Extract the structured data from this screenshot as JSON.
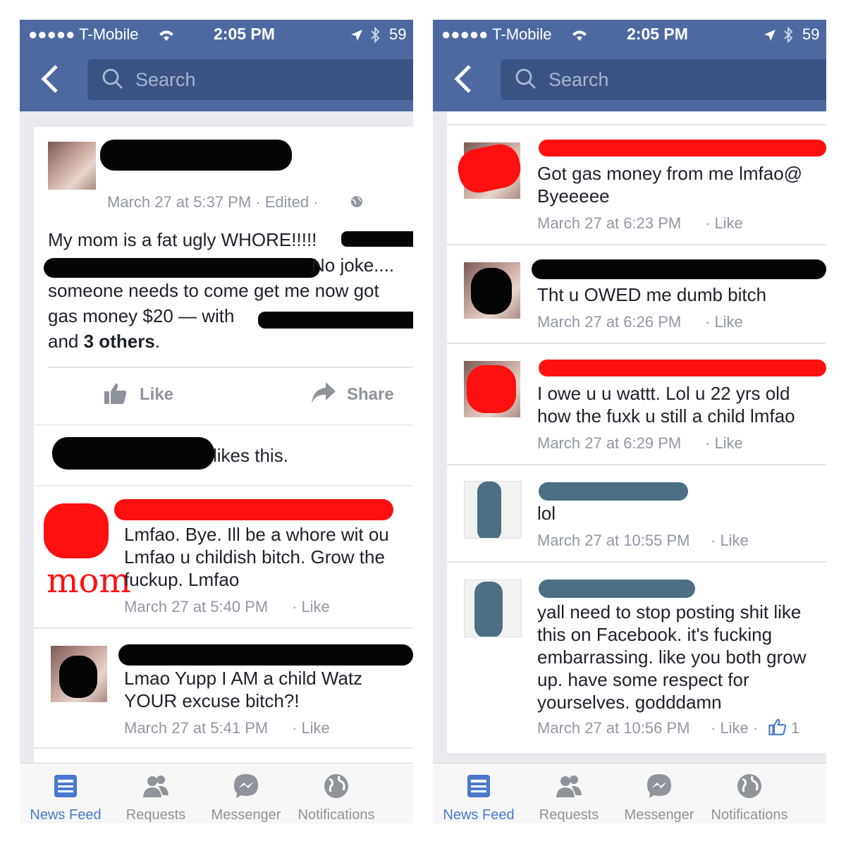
{
  "status": {
    "carrier": "●●●●● T-Mobile",
    "time": "2:05 PM",
    "battery": "59"
  },
  "search": {
    "placeholder": "Search"
  },
  "left": {
    "post": {
      "meta": "March 27 at 5:37 PM · Edited ·",
      "line1": "My mom is a fat ugly WHORE!!!!!",
      "line2": "No joke....",
      "line3": "someone needs to come get me now got",
      "line4a": "gas money $20 — with",
      "line5a": "and",
      "line5b": "3 others",
      "line5c": "."
    },
    "actions": {
      "like": "Like",
      "share": "Share"
    },
    "likes_text": "likes this.",
    "comments": [
      {
        "text1": "Lmfao. Bye. Ill be a whore wit ou",
        "text2": "Lmfao u childish bitch. Grow the",
        "text3": "fuckup. Lmfao",
        "time": "March 27 at 5:40 PM",
        "like": "· Like"
      },
      {
        "text1": "Lmao Yupp I AM a child Watz",
        "text2": "YOUR excuse bitch?!",
        "time": "March 27 at 5:41 PM",
        "like": "· Like"
      }
    ],
    "annotation": "mom"
  },
  "right": {
    "comments": [
      {
        "text1": "Got gas money from me lmfao@",
        "text2": "Byeeeee",
        "time": "March 27 at 6:23 PM",
        "like": "· Like"
      },
      {
        "text1": "Tht u OWED me dumb bitch",
        "time": "March 27 at 6:26 PM",
        "like": "· Like"
      },
      {
        "text1": "I owe u u wattt. Lol u 22 yrs old",
        "text2": "how the fuxk u still a child lmfao",
        "time": "March 27 at 6:29 PM",
        "like": "· Like"
      },
      {
        "text1": "lol",
        "time": "March 27 at 10:55 PM",
        "like": "· Like"
      },
      {
        "text1": "yall need to stop posting shit like",
        "text2": "this on Facebook. it's fucking",
        "text3": "embarrassing. like you both grow",
        "text4": "up. have some respect for",
        "text5": "yourselves. godddamn",
        "time": "March 27 at 10:56 PM",
        "like": "· Like ·",
        "likes_count": "1"
      }
    ]
  },
  "tabs": [
    "News Feed",
    "Requests",
    "Messenger",
    "Notifications"
  ],
  "colors": {
    "header": "#4e69a2",
    "search_bg": "#3b5285",
    "active_tab": "#4a7acb",
    "redact_red": "#ff1010"
  },
  "icons": [
    "back-chevron-icon",
    "search-icon",
    "location-icon",
    "bluetooth-icon",
    "wifi-icon",
    "thumbs-up-icon",
    "share-arrow-icon",
    "globe-icon",
    "news-feed-icon",
    "requests-icon",
    "messenger-icon",
    "notifications-icon"
  ]
}
